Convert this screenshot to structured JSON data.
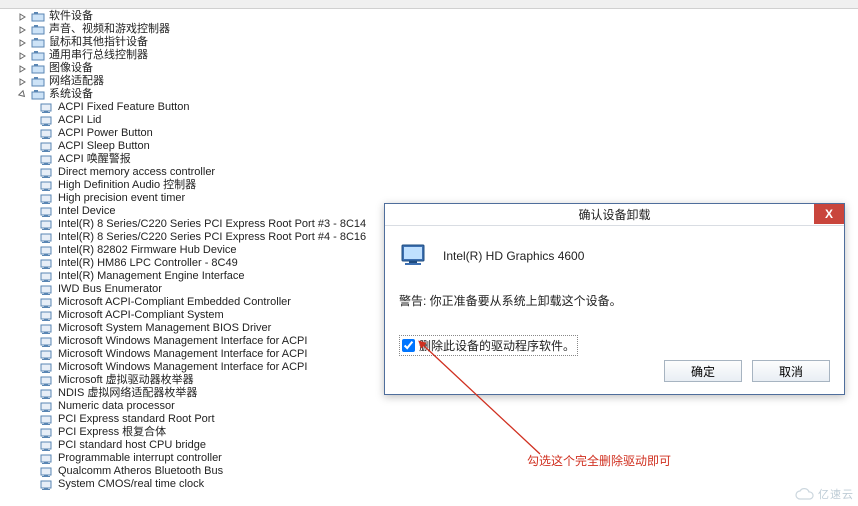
{
  "tree": {
    "categories": [
      {
        "label": "软件设备",
        "expanded": false,
        "icon": "generic"
      },
      {
        "label": "声音、视频和游戏控制器",
        "expanded": false,
        "icon": "sound"
      },
      {
        "label": "鼠标和其他指针设备",
        "expanded": false,
        "icon": "mouse"
      },
      {
        "label": "通用串行总线控制器",
        "expanded": false,
        "icon": "usb"
      },
      {
        "label": "图像设备",
        "expanded": false,
        "icon": "image"
      },
      {
        "label": "网络适配器",
        "expanded": false,
        "icon": "network"
      },
      {
        "label": "系统设备",
        "expanded": true,
        "icon": "computer"
      }
    ],
    "system_devices": [
      "ACPI Fixed Feature Button",
      "ACPI Lid",
      "ACPI Power Button",
      "ACPI Sleep Button",
      "ACPI 唤醒警报",
      "Direct memory access controller",
      "High Definition Audio 控制器",
      "High precision event timer",
      "Intel Device",
      "Intel(R) 8 Series/C220 Series PCI Express Root Port #3 - 8C14",
      "Intel(R) 8 Series/C220 Series PCI Express Root Port #4 - 8C16",
      "Intel(R) 82802 Firmware Hub Device",
      "Intel(R) HM86 LPC Controller - 8C49",
      "Intel(R) Management Engine Interface",
      "IWD Bus Enumerator",
      "Microsoft ACPI-Compliant Embedded Controller",
      "Microsoft ACPI-Compliant System",
      "Microsoft System Management BIOS Driver",
      "Microsoft Windows Management Interface for ACPI",
      "Microsoft Windows Management Interface for ACPI",
      "Microsoft Windows Management Interface for ACPI",
      "Microsoft 虚拟驱动器枚举器",
      "NDIS 虚拟网络适配器枚举器",
      "Numeric data processor",
      "PCI Express standard Root Port",
      "PCI Express 根复合体",
      "PCI standard host CPU bridge",
      "Programmable interrupt controller",
      "Qualcomm Atheros Bluetooth Bus",
      "System CMOS/real time clock"
    ]
  },
  "dialog": {
    "title": "确认设备卸载",
    "device_name": "Intel(R) HD Graphics 4600",
    "warning": "警告: 你正准备要从系统上卸载这个设备。",
    "checkbox_label": "删除此设备的驱动程序软件。",
    "checkbox_checked": true,
    "buttons": {
      "ok": "确定",
      "cancel": "取消"
    },
    "close_label": "X"
  },
  "annotation": {
    "text": "勾选这个完全删除驱动即可"
  },
  "watermark": {
    "text": "亿速云"
  }
}
